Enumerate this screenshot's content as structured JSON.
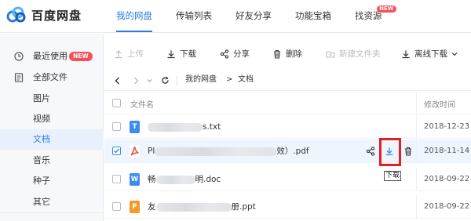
{
  "brand": {
    "name": "百度网盘"
  },
  "nav": [
    {
      "label": "我的网盘",
      "active": true
    },
    {
      "label": "传输列表"
    },
    {
      "label": "好友分享"
    },
    {
      "label": "功能宝箱"
    },
    {
      "label": "找资源",
      "badge": "NEW"
    }
  ],
  "sidebar": {
    "items": [
      {
        "label": "最近使用",
        "icon": "clock-icon",
        "badge": "NEW"
      },
      {
        "label": "全部文件",
        "icon": "file-icon"
      },
      {
        "label": "图片"
      },
      {
        "label": "视频"
      },
      {
        "label": "文档",
        "active": true
      },
      {
        "label": "音乐"
      },
      {
        "label": "种子"
      },
      {
        "label": "其它"
      }
    ]
  },
  "toolbar": {
    "upload": "上传",
    "download": "下载",
    "share": "分享",
    "delete": "删除",
    "new_folder": "新建文件夹",
    "offline_download": "离线下载"
  },
  "path": {
    "root": "我的网盘",
    "sep": ">",
    "current": "文档"
  },
  "table": {
    "col_name": "文件名",
    "col_date": "修改时间",
    "rows": [
      {
        "type": "T",
        "type_color": "#3b8cf0",
        "prefix": "",
        "suffix": "s.txt",
        "date": "2018-12-23"
      },
      {
        "type": "pdf",
        "type_color": "#f0574a",
        "prefix": "Pl",
        "suffix": "效）.pdf",
        "date": "2018-11-14",
        "selected": true
      },
      {
        "type": "W",
        "type_color": "#3b8cf0",
        "prefix": "畅",
        "suffix": "明.doc",
        "date": "2018-09-22"
      },
      {
        "type": "P",
        "type_color": "#f39a2b",
        "prefix": "友",
        "suffix": "册.ppt",
        "date": "2018-09-22"
      }
    ]
  },
  "tooltip": {
    "download": "下载"
  },
  "colors": {
    "accent": "#2a7de1",
    "highlight": "#e31e24",
    "badge": "#f5505a"
  }
}
